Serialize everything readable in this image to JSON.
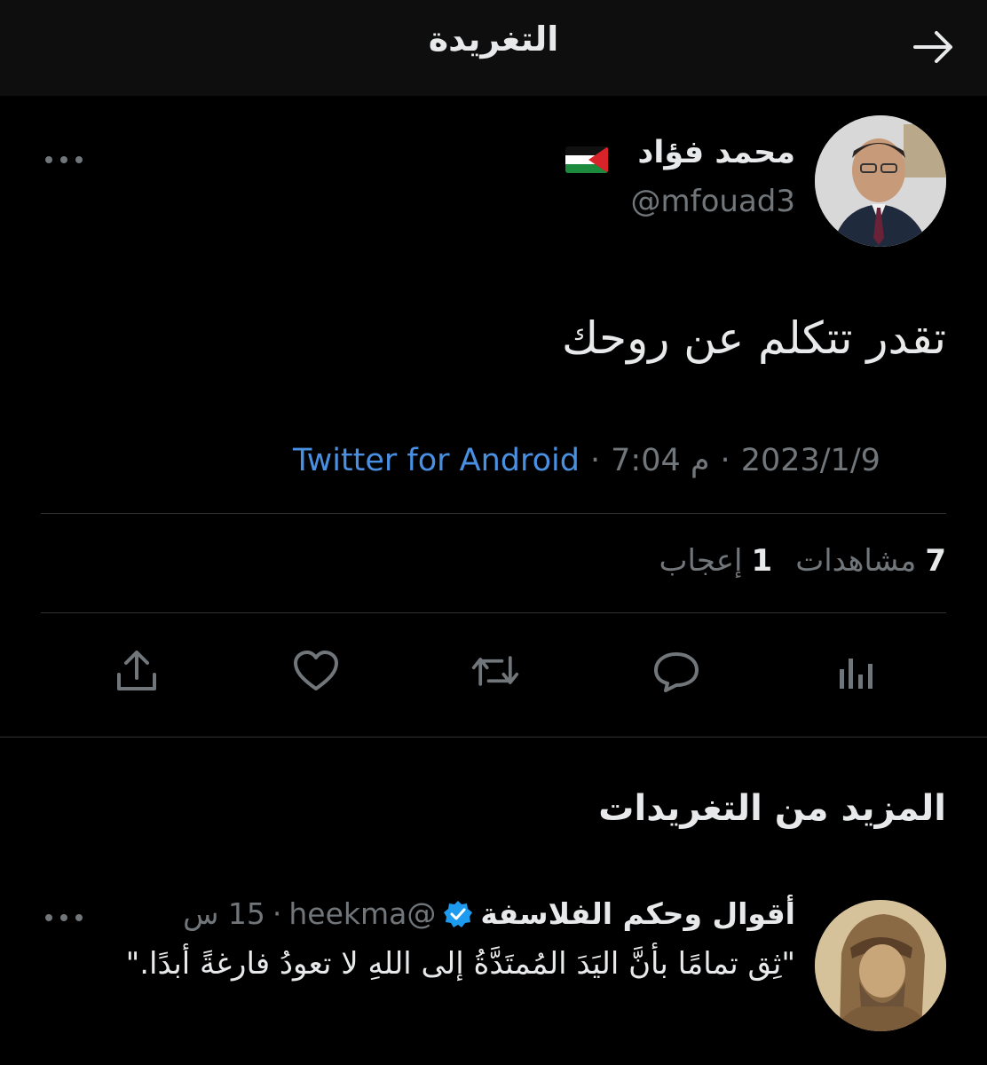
{
  "header": {
    "title": "التغريدة",
    "back_icon": "arrow-right-icon"
  },
  "tweet": {
    "author_name": "محمد فؤاد",
    "author_handle": "@mfouad3",
    "flag_icon": "palestine-flag-icon",
    "text": "تقدر تتكلم عن روحك",
    "date": "2023/1/9",
    "time": "7:04 م",
    "separator": "·",
    "source": "Twitter for Android",
    "views_count": "7",
    "views_label": "مشاهدات",
    "likes_count": "1",
    "likes_label": "إعجاب"
  },
  "actions": [
    {
      "name": "analytics",
      "icon": "bar-chart-icon"
    },
    {
      "name": "reply",
      "icon": "speech-bubble-icon"
    },
    {
      "name": "retweet",
      "icon": "retweet-icon"
    },
    {
      "name": "like",
      "icon": "heart-icon"
    },
    {
      "name": "share",
      "icon": "share-icon"
    }
  ],
  "more_section": {
    "title": "المزيد من التغريدات",
    "tweet": {
      "author_name": "أقوال وحكم الفلاسفة",
      "verified": true,
      "handle": "@heekma",
      "separator": "·",
      "time": "15 س",
      "text": "\"ثِق تمامًا بأنَّ اليَدَ المُمتَدَّةُ إلى اللهِ لا تعودُ فارغةً أبدًا.\""
    }
  },
  "colors": {
    "background": "#000000",
    "header_bg": "#0e0e0e",
    "text_primary": "#e7e9ea",
    "text_secondary": "#71767b",
    "link": "#4a90e2",
    "divider": "#2f3336",
    "verified": "#1d9bf0"
  }
}
